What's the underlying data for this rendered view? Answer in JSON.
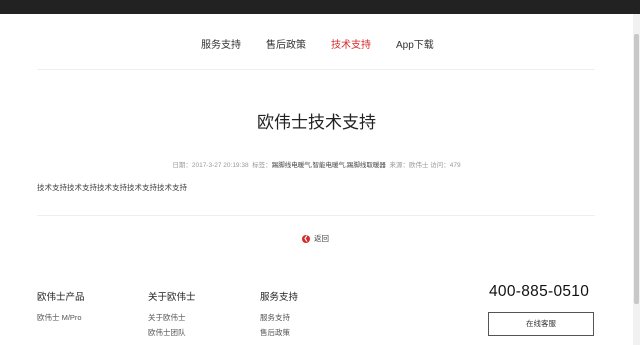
{
  "subnav": {
    "items": [
      "服务支持",
      "售后政策",
      "技术支持",
      "App下载"
    ],
    "active": "技术支持"
  },
  "article": {
    "title": "欧伟士技术支持",
    "meta": {
      "date_label": "日期：",
      "date": "2017-3-27 20:19:38",
      "tags_label": "标签：",
      "tags": "踢脚线电暖气,智能电暖气,踢脚线取暖器",
      "source_label": "来源：",
      "source": "欧伟士",
      "visits_label": "访问：",
      "visits": "479"
    },
    "body": "技术支持技术支持技术支持技术支持技术支持"
  },
  "back": {
    "label": "返回",
    "icon": "arrow-left-icon"
  },
  "footer": {
    "columns": [
      {
        "heading": "欧伟士产品",
        "items": [
          "欧伟士 M/Pro"
        ]
      },
      {
        "heading": "关于欧伟士",
        "items": [
          "关于欧伟士",
          "欧伟士团队"
        ]
      },
      {
        "heading": "服务支持",
        "items": [
          "服务支持",
          "售后政策"
        ]
      }
    ],
    "phone": "400-885-0510",
    "service_button": "在线客服"
  },
  "colors": {
    "accent": "#d42b2b",
    "topbar": "#222222"
  }
}
